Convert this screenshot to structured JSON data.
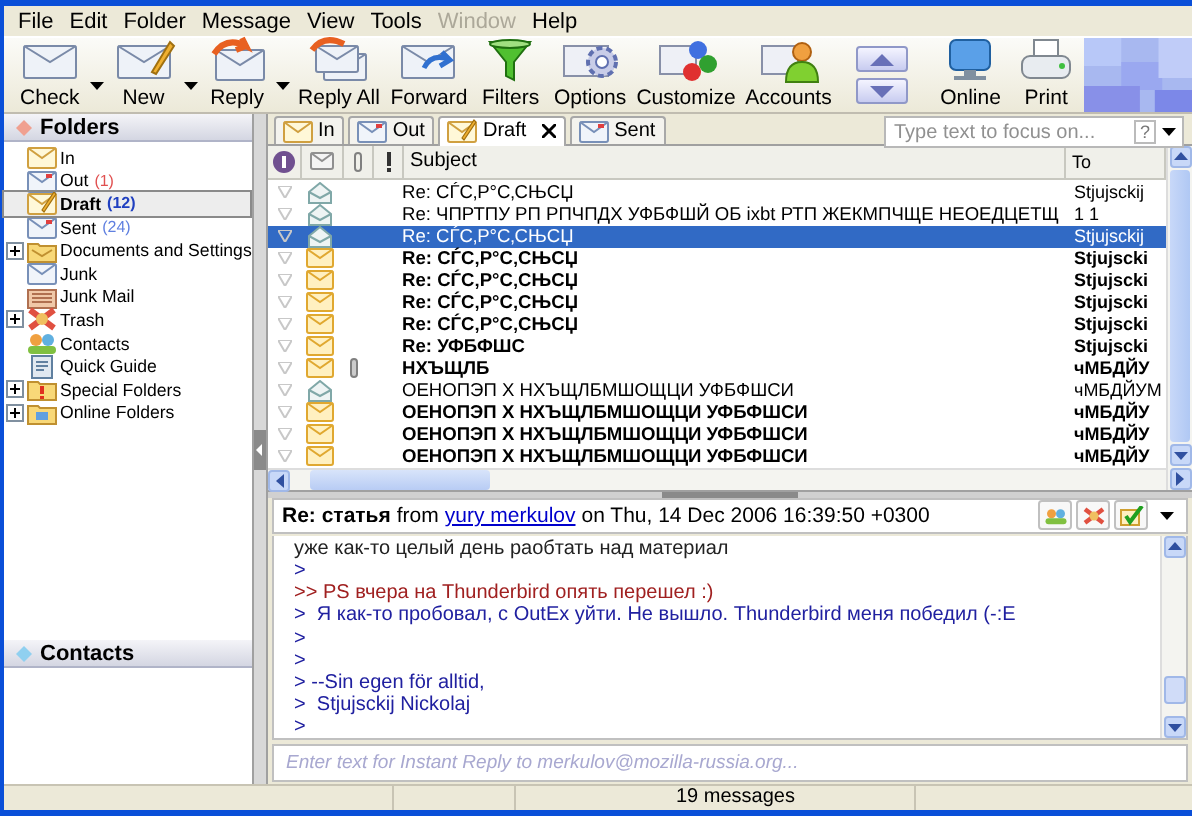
{
  "menu": [
    {
      "label": "File",
      "disabled": false
    },
    {
      "label": "Edit",
      "disabled": false
    },
    {
      "label": "Folder",
      "disabled": false
    },
    {
      "label": "Message",
      "disabled": false
    },
    {
      "label": "View",
      "disabled": false
    },
    {
      "label": "Tools",
      "disabled": false
    },
    {
      "label": "Window",
      "disabled": true
    },
    {
      "label": "Help",
      "disabled": false
    }
  ],
  "toolbar": {
    "buttons": [
      {
        "label": "Check",
        "kind": "check",
        "has_menu": true
      },
      {
        "label": "New",
        "kind": "new",
        "has_menu": true
      },
      {
        "label": "Reply",
        "kind": "reply",
        "has_menu": true
      },
      {
        "label": "Reply All",
        "kind": "replyall",
        "has_menu": false
      },
      {
        "label": "Forward",
        "kind": "forward",
        "has_menu": false
      },
      {
        "label": "Filters",
        "kind": "filters",
        "has_menu": false
      },
      {
        "label": "Options",
        "kind": "options",
        "has_menu": false
      },
      {
        "label": "Customize",
        "kind": "customize",
        "has_menu": false
      },
      {
        "label": "Accounts",
        "kind": "accounts",
        "has_menu": false
      },
      {
        "kind": "arrows"
      },
      {
        "label": "Online",
        "kind": "online",
        "has_menu": false
      },
      {
        "label": "Print",
        "kind": "print",
        "has_menu": false
      }
    ]
  },
  "folder_pane": {
    "title": "Folders",
    "folders": [
      {
        "name": "In",
        "kind": "inbox",
        "expander": false,
        "selected": false
      },
      {
        "name": "Out",
        "kind": "outbox",
        "count": "(1)",
        "color": "#e05050",
        "expander": false,
        "selected": false
      },
      {
        "name": "Draft",
        "kind": "draft",
        "count": "(12)",
        "color": "#2040c0",
        "expander": false,
        "selected": true
      },
      {
        "name": "Sent",
        "kind": "sent",
        "count": "(24)",
        "color": "#6080e0",
        "expander": false,
        "selected": false
      },
      {
        "name": "Documents and Settings",
        "kind": "folder",
        "expander": true,
        "selected": false
      },
      {
        "name": "Junk",
        "kind": "junk",
        "expander": false,
        "selected": false
      },
      {
        "name": "Junk Mail",
        "kind": "junkmail",
        "expander": false,
        "selected": false
      },
      {
        "name": "Trash",
        "kind": "trash",
        "expander": true,
        "selected": false
      },
      {
        "name": "Contacts",
        "kind": "contacts",
        "expander": false,
        "selected": false
      },
      {
        "name": "Quick Guide",
        "kind": "guide",
        "expander": false,
        "selected": false
      },
      {
        "name": "Special Folders",
        "kind": "special",
        "expander": true,
        "selected": false
      },
      {
        "name": "Online Folders",
        "kind": "online",
        "expander": true,
        "selected": false
      }
    ]
  },
  "contacts_pane": {
    "title": "Contacts"
  },
  "tabs": [
    {
      "label": "In",
      "kind": "inbox",
      "selected": false
    },
    {
      "label": "Out",
      "kind": "outbox",
      "selected": false
    },
    {
      "label": "Draft",
      "kind": "draft",
      "selected": true
    },
    {
      "label": "Sent",
      "kind": "sent",
      "selected": false
    }
  ],
  "search": {
    "placeholder": "Type text to focus on...",
    "help": "?"
  },
  "message_list": {
    "columns": [
      "Subject",
      "To"
    ],
    "rows": [
      {
        "subject": "Re: СЃС‚Р°С‚СЊСЏ",
        "to": "Stjujsckij",
        "unread": false,
        "selected": false,
        "attachment": false
      },
      {
        "subject": "Re: ЧПРТПУ РП РПЧПДХ УФБФШЙ ОБ ixbt РТП ЖЕКМПЧЩЕ НЕОЕДЦЕТЩ",
        "to": "1 1",
        "unread": false,
        "selected": false,
        "attachment": false
      },
      {
        "subject": "Re: СЃС‚Р°С‚СЊСЏ",
        "to": "Stjujsckij",
        "unread": false,
        "selected": true,
        "attachment": false
      },
      {
        "subject": "Re: СЃС‚Р°С‚СЊСЏ",
        "to": "Stjujscki",
        "unread": true,
        "selected": false,
        "attachment": false
      },
      {
        "subject": "Re: СЃС‚Р°С‚СЊСЏ",
        "to": "Stjujscki",
        "unread": true,
        "selected": false,
        "attachment": false
      },
      {
        "subject": "Re: СЃС‚Р°С‚СЊСЏ",
        "to": "Stjujscki",
        "unread": true,
        "selected": false,
        "attachment": false
      },
      {
        "subject": "Re: СЃС‚Р°С‚СЊСЏ",
        "to": "Stjujscki",
        "unread": true,
        "selected": false,
        "attachment": false
      },
      {
        "subject": "Re: УФБФШС",
        "to": "Stjujscki",
        "unread": true,
        "selected": false,
        "attachment": false
      },
      {
        "subject": "НХЪЩЛБ",
        "to": "чМБДЙУ",
        "unread": true,
        "selected": false,
        "attachment": true
      },
      {
        "subject": "ОЕНОПЭП Х НХЪЩЛБМШОЩЦИ УФБФШСИ",
        "to": "чМБДЙУМ",
        "unread": false,
        "selected": false,
        "attachment": false
      },
      {
        "subject": "ОЕНОПЭП Х НХЪЩЛБМШОЩЦИ УФБФШСИ",
        "to": "чМБДЙУ",
        "unread": true,
        "selected": false,
        "attachment": false
      },
      {
        "subject": "ОЕНОПЭП Х НХЪЩЛБМШОЩЦИ УФБФШСИ",
        "to": "чМБДЙУ",
        "unread": true,
        "selected": false,
        "attachment": false
      },
      {
        "subject": "ОЕНОПЭП Х НХЪЩЛБМШОЩЦИ УФБФШСИ",
        "to": "чМБДЙУ",
        "unread": true,
        "selected": false,
        "attachment": false
      }
    ]
  },
  "preview": {
    "subject": "Re: статья",
    "from_label": "from",
    "sender": "yury merkulov",
    "date": "on Thu, 14 Dec 2006 16:39:50 +0300",
    "lines": [
      {
        "kind": "plain",
        "text": "уже как-то целый день раобтать над материал"
      },
      {
        "kind": "quote",
        "text": ">"
      },
      {
        "kind": "quote2",
        "text": ">> PS вчера на Thunderbird опять перешел :)"
      },
      {
        "kind": "quote",
        "text": ">  Я как-то пробовал, с OutEx уйти. Не вышло. Thunderbird меня победил (-:E"
      },
      {
        "kind": "quote",
        "text": ">"
      },
      {
        "kind": "quote",
        "text": ">"
      },
      {
        "kind": "quote",
        "text": "> --Sin egen för alltid,"
      },
      {
        "kind": "quote",
        "text": ">  Stjujsckij Nickolaj"
      },
      {
        "kind": "quote",
        "text": ">"
      }
    ]
  },
  "instant_reply": {
    "placeholder": "Enter text for Instant Reply to merkulov@mozilla-russia.org..."
  },
  "status_bar": {
    "text": "19 messages"
  }
}
